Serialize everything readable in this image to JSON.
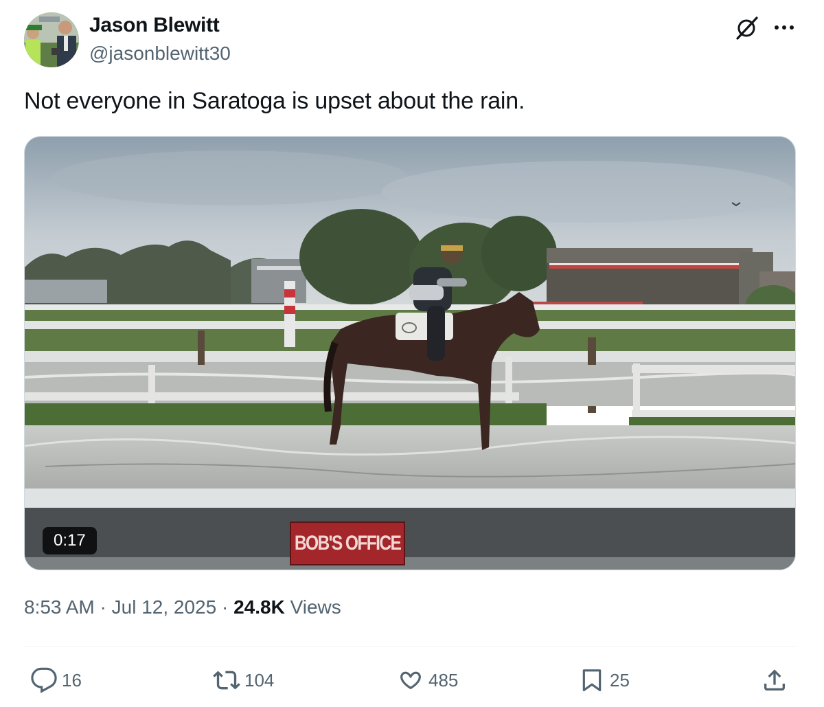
{
  "author": {
    "name": "Jason Blewitt",
    "handle": "@jasonblewitt30"
  },
  "tweet": {
    "text": "Not everyone in Saratoga is upset about the rain."
  },
  "media": {
    "duration": "0:17",
    "sign_text": "BOB'S OFFICE"
  },
  "meta": {
    "time": "8:53 AM",
    "separator1": " · ",
    "date": "Jul 12, 2025",
    "separator2": " · ",
    "views_count": "24.8K",
    "views_label": " Views"
  },
  "actions": {
    "replies": "16",
    "reposts": "104",
    "likes": "485",
    "bookmarks": "25"
  },
  "icons": [
    "grok-icon",
    "more-icon",
    "reply-icon",
    "repost-icon",
    "like-icon",
    "bookmark-icon",
    "share-icon"
  ],
  "colors": {
    "text_primary": "#0f1419",
    "text_secondary": "#536471",
    "divider": "#eff3f4"
  }
}
